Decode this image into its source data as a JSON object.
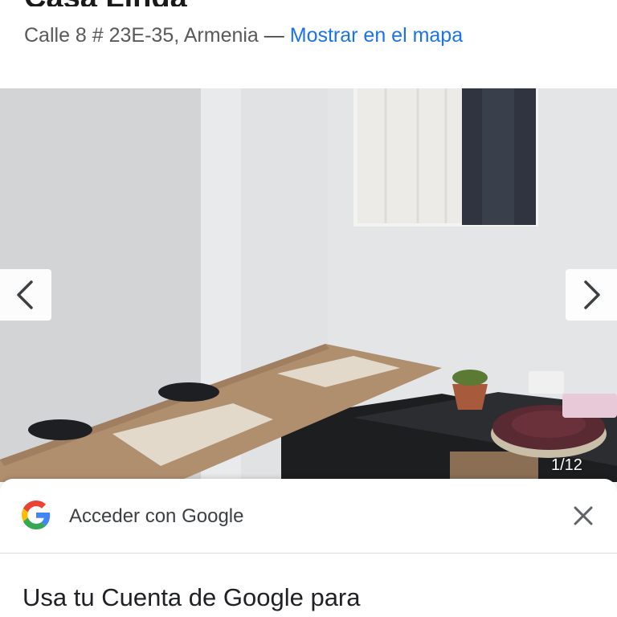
{
  "listing": {
    "title": "Casa Linda",
    "address": "Calle 8 # 23E-35, Armenia",
    "separator": "—",
    "map_link": "Mostrar en el mapa"
  },
  "gallery": {
    "counter": "1/12",
    "prev_icon": "chevron-left-icon",
    "next_icon": "chevron-right-icon"
  },
  "google_signin": {
    "header": "Acceder con Google",
    "body_text": "Usa tu Cuenta de Google para",
    "close_icon": "close-icon",
    "logo_icon": "google-g-icon"
  },
  "colors": {
    "link": "#1a73e8",
    "google_blue": "#4285F4",
    "google_red": "#EA4335",
    "google_yellow": "#FBBC05",
    "google_green": "#34A853"
  }
}
